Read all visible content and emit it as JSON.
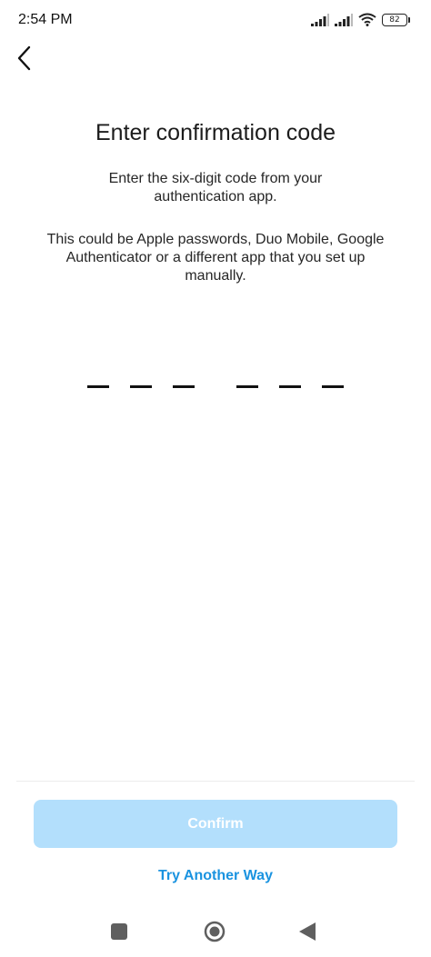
{
  "status_bar": {
    "time": "2:54 PM",
    "battery_level": "82",
    "icons": [
      "signal-icon",
      "signal-icon",
      "wifi-icon",
      "battery-icon"
    ]
  },
  "header": {
    "back_icon": "chevron-left-icon"
  },
  "main": {
    "title": "Enter confirmation code",
    "subtitle": "Enter the six-digit code from your authentication app.",
    "apps_note": "This could be Apple passwords, Duo Mobile, Google Authenticator or a different app that you set up manually.",
    "code": {
      "length": 6,
      "value": ""
    }
  },
  "footer": {
    "confirm_label": "Confirm",
    "try_another_label": "Try Another Way",
    "confirm_color": "#b3dffc",
    "link_color": "#1a93e0"
  },
  "nav_bar": {
    "icons": [
      "recent-apps-icon",
      "home-icon",
      "back-icon"
    ]
  }
}
